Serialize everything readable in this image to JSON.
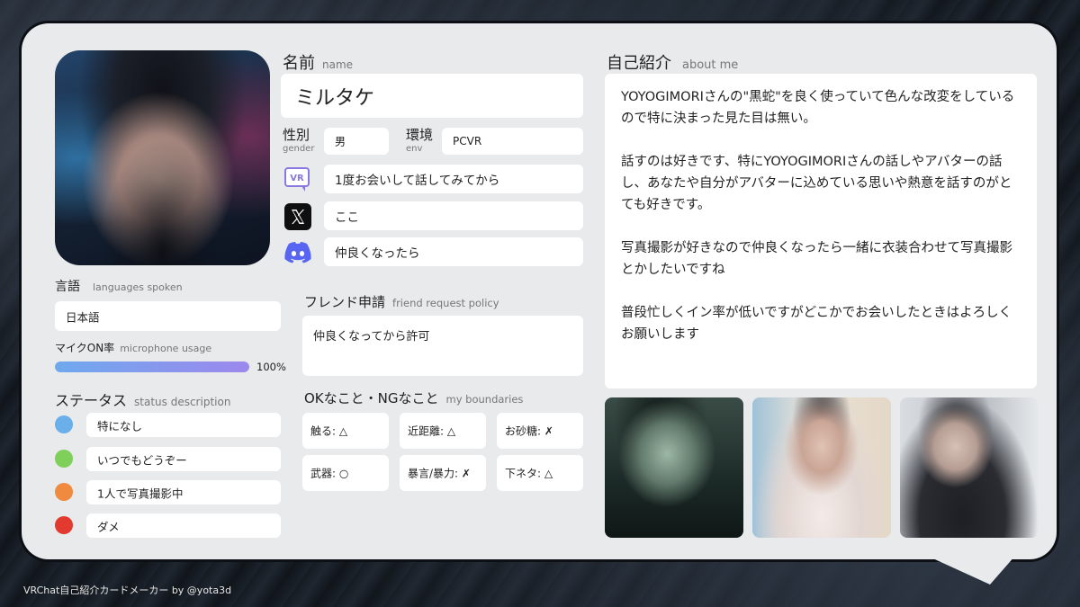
{
  "profile": {
    "name_ja": "名前",
    "name_en": "name",
    "name_value": "ミルタケ",
    "gender_ja": "性別",
    "gender_en": "gender",
    "gender_value": "男",
    "env_ja": "環境",
    "env_en": "env",
    "env_value": "PCVR"
  },
  "social": {
    "vr_value": "1度お会いして話してみてから",
    "x_value": "ここ",
    "discord_value": "仲良くなったら",
    "vr_icon_label": "VR"
  },
  "languages": {
    "label_ja": "言語",
    "label_en": "languages spoken",
    "value": "日本語"
  },
  "mic": {
    "label_ja": "マイクON率",
    "label_en": "microphone usage",
    "percent": 100,
    "percent_text": "100%"
  },
  "status": {
    "label_ja": "ステータス",
    "label_en": "status description",
    "items": [
      {
        "color": "#6aaeea",
        "text": "特になし"
      },
      {
        "color": "#7ed05a",
        "text": "いつでもどうぞー"
      },
      {
        "color": "#ef8a3e",
        "text": "1人で写真撮影中"
      },
      {
        "color": "#e23a2e",
        "text": "ダメ"
      }
    ]
  },
  "friend": {
    "label_ja": "フレンド申請",
    "label_en": "friend request policy",
    "value": "仲良くなってから許可"
  },
  "boundaries": {
    "label_ja": "OKなこと・NGなこと",
    "label_en": "my boundaries",
    "items": [
      "触る: △",
      "近距離: △",
      "お砂糖: ✗",
      "武器: ○",
      "暴言/暴力: ✗",
      "下ネタ: △"
    ]
  },
  "about": {
    "label_ja": "自己紹介",
    "label_en": "about me",
    "text": "YOYOGIMORIさんの\"黒蛇\"を良く使っていて色んな改変をしているので特に決まった見た目は無い。\n\n話すのは好きです、特にYOYOGIMORIさんの話しやアバターの話し、あなたや自分がアバターに込めている思いや熱意を話すのがとても好きです。\n\n写真撮影が好きなので仲良くなったら一緒に衣装合わせて写真撮影とかしたいですね\n\n普段忙しくイン率が低いですがどこかでお会いしたときはよろしくお願いします"
  },
  "footer": "VRChat自己紹介カードメーカー by @yota3d",
  "colors": {
    "card_bg": "#e9eaec",
    "box_bg": "#ffffff",
    "progress_start": "#6fa9ee",
    "progress_end": "#9d88ee",
    "discord": "#5865f2",
    "vr_icon": "#8a78e0"
  }
}
